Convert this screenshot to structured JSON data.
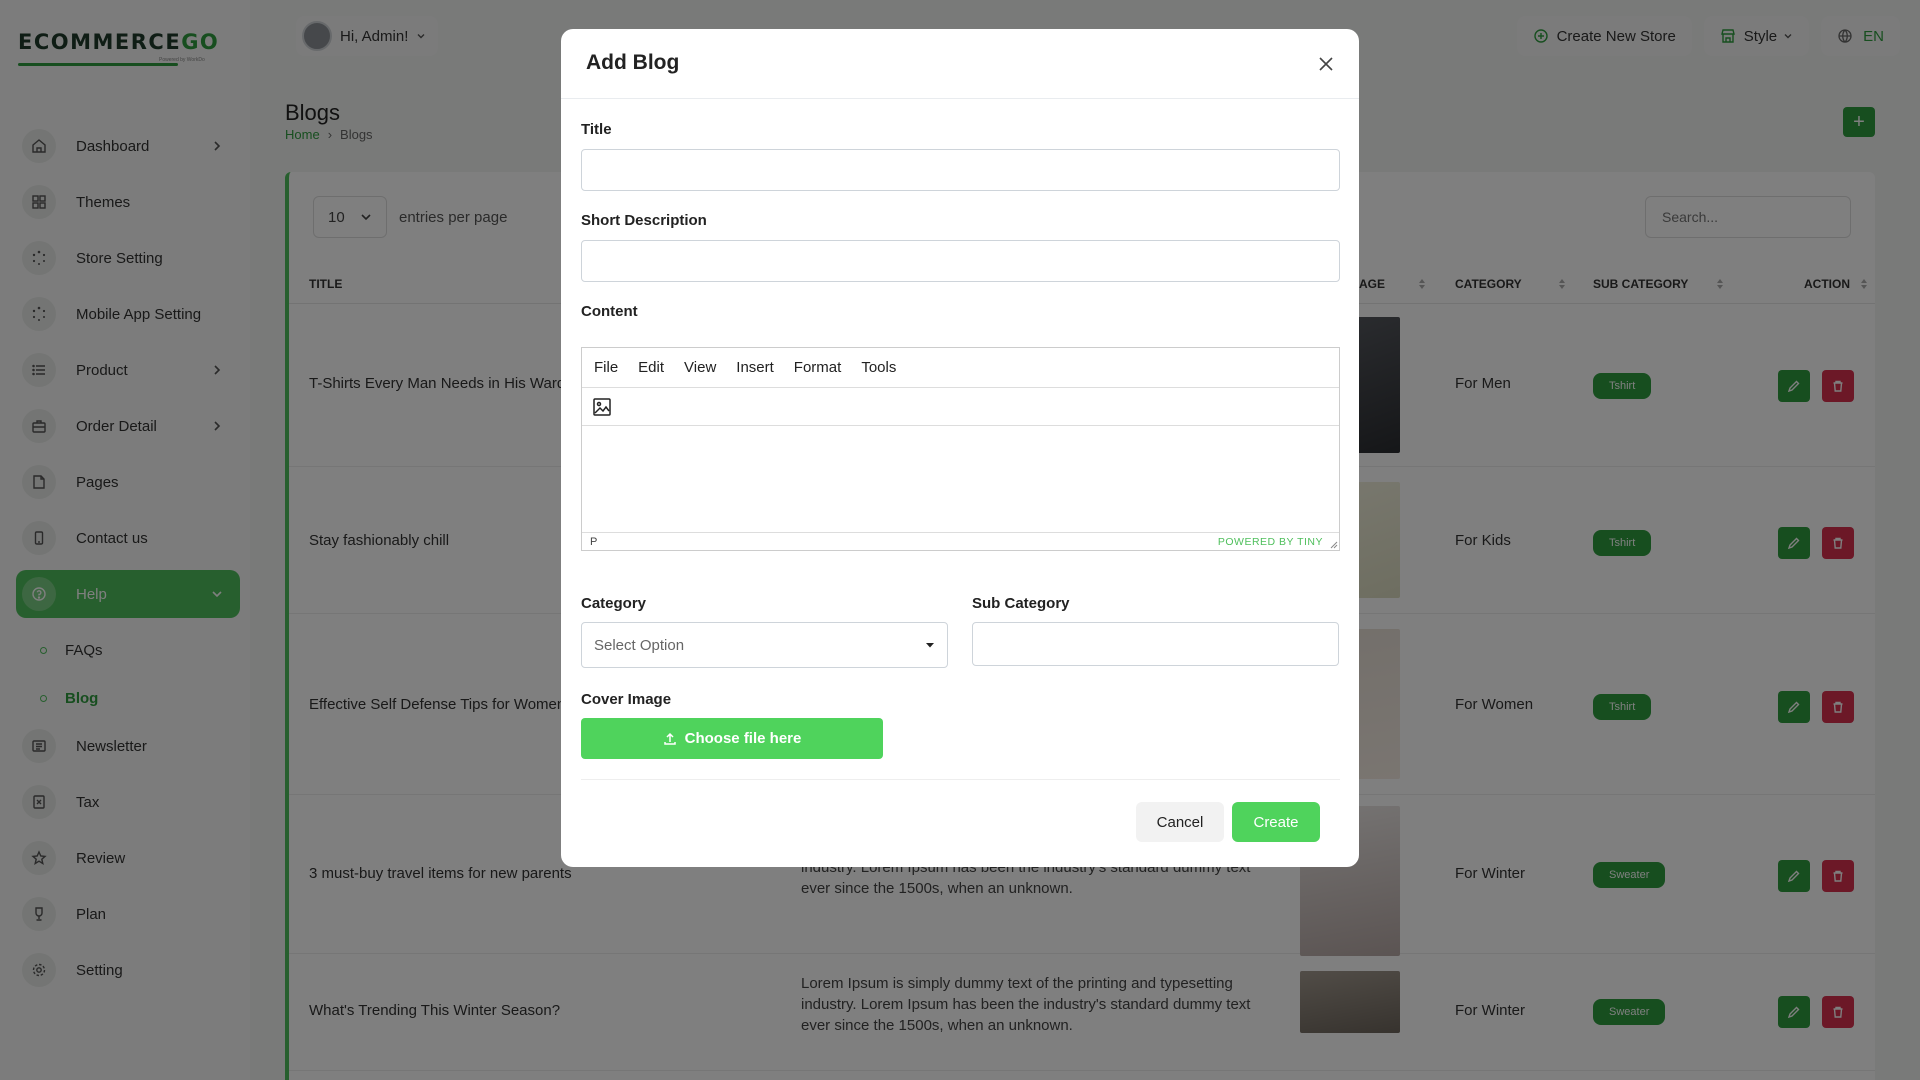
{
  "brand": {
    "logo_main": "ECOMMERCE",
    "logo_accent": "GO",
    "logo_sub": "Powered by WorkDo"
  },
  "colors": {
    "accent": "#4fbf5c",
    "accent_dark": "#2e9d3e",
    "danger": "#d9304f"
  },
  "sidebar": {
    "items": [
      {
        "label": "Dashboard",
        "icon": "home-icon",
        "chevron": true
      },
      {
        "label": "Themes",
        "icon": "grid-icon",
        "chevron": false
      },
      {
        "label": "Store Setting",
        "icon": "spinner-icon",
        "chevron": false
      },
      {
        "label": "Mobile App Setting",
        "icon": "spinner-icon",
        "chevron": false
      },
      {
        "label": "Product",
        "icon": "list-icon",
        "chevron": true
      },
      {
        "label": "Order Detail",
        "icon": "briefcase-icon",
        "chevron": true
      },
      {
        "label": "Pages",
        "icon": "file-icon",
        "chevron": false
      },
      {
        "label": "Contact us",
        "icon": "phone-icon",
        "chevron": false
      },
      {
        "label": "Help",
        "icon": "help-icon",
        "chevron": true,
        "active": true
      },
      {
        "label": "Newsletter",
        "icon": "newspaper-icon",
        "chevron": false
      },
      {
        "label": "Tax",
        "icon": "receipt-icon",
        "chevron": false
      },
      {
        "label": "Review",
        "icon": "star-icon",
        "chevron": false
      },
      {
        "label": "Plan",
        "icon": "trophy-icon",
        "chevron": false
      },
      {
        "label": "Setting",
        "icon": "gear-icon",
        "chevron": false
      }
    ],
    "help_sub": [
      {
        "label": "FAQs",
        "active": false
      },
      {
        "label": "Blog",
        "active": true
      }
    ]
  },
  "header": {
    "greeting": "Hi, Admin!",
    "create_store": "Create New Store",
    "style": "Style",
    "language": "EN"
  },
  "page": {
    "title": "Blogs",
    "breadcrumb_home": "Home",
    "breadcrumb_current": "Blogs",
    "add_button": "+"
  },
  "table": {
    "entries_value": "10",
    "entries_label": "entries per page",
    "search_placeholder": "Search...",
    "columns": {
      "title": "TITLE",
      "image": "AGE",
      "category": "CATEGORY",
      "sub_category": "SUB CATEGORY",
      "action": "ACTION"
    },
    "rows": [
      {
        "title": "T-Shirts Every Man Needs in His Wardr",
        "description": "",
        "category": "For Men",
        "sub_category": "Tshirt"
      },
      {
        "title": "Stay fashionably chill",
        "description": "",
        "category": "For Kids",
        "sub_category": "Tshirt"
      },
      {
        "title": "Effective Self Defense Tips for Women",
        "description": "",
        "category": "For Women",
        "sub_category": "Tshirt"
      },
      {
        "title": "3 must-buy travel items for new parents",
        "description": "Lorem Ipsum is simply dummy text of the printing and typesetting industry. Lorem Ipsum has been the industry's standard dummy text ever since the 1500s, when an unknown.",
        "category": "For Winter",
        "sub_category": "Sweater"
      },
      {
        "title": "What's Trending This Winter Season?",
        "description": "Lorem Ipsum is simply dummy text of the printing and typesetting industry. Lorem Ipsum has been the industry's standard dummy text ever since the 1500s, when an unknown.",
        "category": "For Winter",
        "sub_category": "Sweater"
      }
    ]
  },
  "modal": {
    "title": "Add Blog",
    "title_label": "Title",
    "title_value": "",
    "short_desc_label": "Short Description",
    "short_desc_value": "",
    "content_label": "Content",
    "editor_menu": [
      "File",
      "Edit",
      "View",
      "Insert",
      "Format",
      "Tools"
    ],
    "editor_status_path": "P",
    "editor_powered": "POWERED BY TINY",
    "category_label": "Category",
    "category_selected": "Select Option",
    "sub_category_label": "Sub Category",
    "sub_category_value": "",
    "cover_image_label": "Cover Image",
    "file_button": "Choose file here",
    "cancel": "Cancel",
    "create": "Create"
  }
}
